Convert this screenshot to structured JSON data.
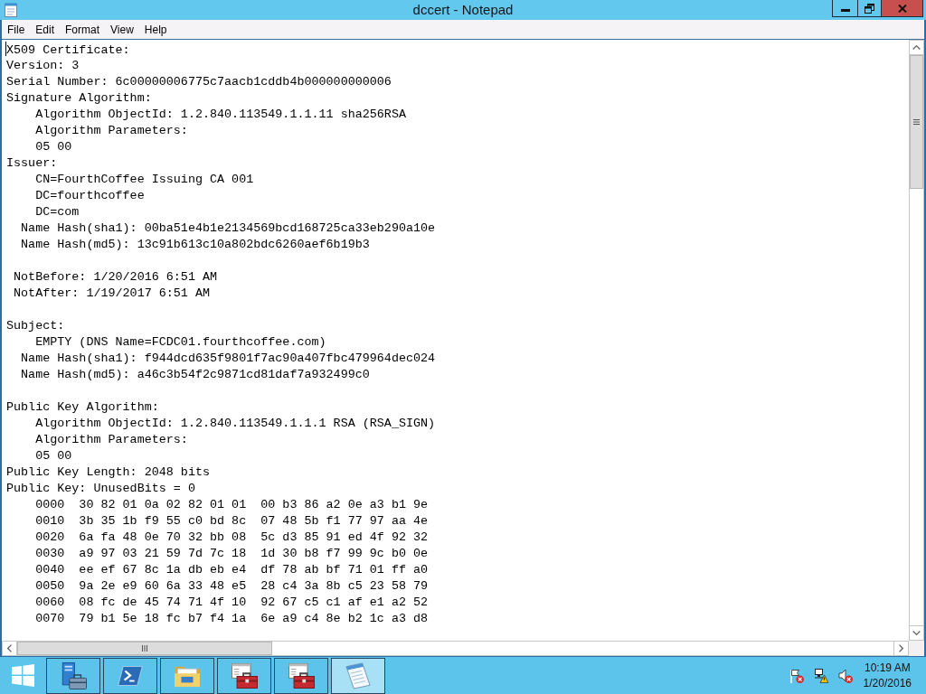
{
  "window": {
    "title": "dccert - Notepad",
    "maximized": true
  },
  "menu": [
    "File",
    "Edit",
    "Format",
    "View",
    "Help"
  ],
  "editor": {
    "blocks": [
      {
        "lines": [
          "X509 Certificate:",
          "Version: 3",
          "Serial Number: 6c00000006775c7aacb1cddb4b000000000006",
          "Signature Algorithm:",
          "    Algorithm ObjectId: 1.2.840.113549.1.1.11 sha256RSA",
          "    Algorithm Parameters:",
          "    05 00",
          "Issuer:",
          "    CN=FourthCoffee Issuing CA 001",
          "    DC=fourthcoffee",
          "    DC=com",
          "  Name Hash(sha1): 00ba51e4b1e2134569bcd168725ca33eb290a10e",
          "  Name Hash(md5): 13c91b613c10a802bdc6260aef6b19b3"
        ]
      },
      {
        "lines": [
          " NotBefore: 1/20/2016 6:51 AM",
          " NotAfter: 1/19/2017 6:51 AM"
        ]
      },
      {
        "lines": [
          "Subject:",
          "    EMPTY (DNS Name=FCDC01.fourthcoffee.com)",
          "  Name Hash(sha1): f944dcd635f9801f7ac90a407fbc479964dec024",
          "  Name Hash(md5): a46c3b54f2c9871cd81daf7a932499c0"
        ]
      },
      {
        "lines": [
          "Public Key Algorithm:",
          "    Algorithm ObjectId: 1.2.840.113549.1.1.1 RSA (RSA_SIGN)",
          "    Algorithm Parameters:",
          "    05 00",
          "Public Key Length: 2048 bits",
          "Public Key: UnusedBits = 0",
          "    0000  30 82 01 0a 02 82 01 01  00 b3 86 a2 0e a3 b1 9e",
          "    0010  3b 35 1b f9 55 c0 bd 8c  07 48 5b f1 77 97 aa 4e",
          "    0020  6a fa 48 0e 70 32 bb 08  5c d3 85 91 ed 4f 92 32",
          "    0030  a9 97 03 21 59 7d 7c 18  1d 30 b8 f7 99 9c b0 0e",
          "    0040  ee ef 67 8c 1a db eb e4  df 78 ab bf 71 01 ff a0",
          "    0050  9a 2e e9 60 6a 33 48 e5  28 c4 3a 8b c5 23 58 79",
          "    0060  08 fc de 45 74 71 4f 10  92 67 c5 c1 af e1 a2 52",
          "    0070  79 b1 5e 18 fc b7 f4 1a  6e a9 c4 8e b2 1c a3 d8"
        ]
      }
    ]
  },
  "taskbar": {
    "apps": [
      {
        "kind": "server",
        "selected": false
      },
      {
        "kind": "terminal",
        "selected": false
      },
      {
        "kind": "folder",
        "selected": false
      },
      {
        "kind": "toolbox",
        "selected": false
      },
      {
        "kind": "toolbox",
        "selected": false
      },
      {
        "kind": "notepad",
        "selected": true
      }
    ],
    "clock": {
      "time": "10:19 AM",
      "date": "1/20/2016"
    }
  }
}
